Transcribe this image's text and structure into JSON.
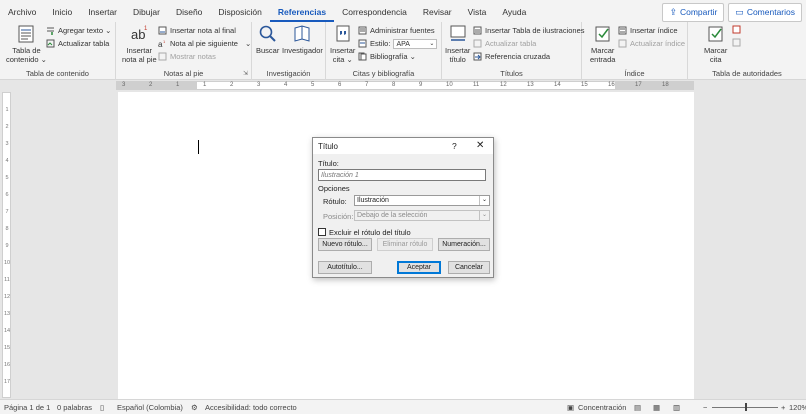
{
  "tabs": [
    "Archivo",
    "Inicio",
    "Insertar",
    "Dibujar",
    "Diseño",
    "Disposición",
    "Referencias",
    "Correspondencia",
    "Revisar",
    "Vista",
    "Ayuda"
  ],
  "active_tab": "Referencias",
  "share_label": "Compartir",
  "comments_label": "Comentarios",
  "ribbon": {
    "toc": {
      "group_label": "Tabla de contenido",
      "table_btn_line1": "Tabla de",
      "table_btn_line2": "contenido ⌄",
      "add_text": "Agregar texto ⌄",
      "update_table": "Actualizar tabla"
    },
    "footnotes": {
      "group_label": "Notas al pie",
      "insert_line1": "Insertar",
      "insert_line2": "nota al pie",
      "endnote": "Insertar nota al final",
      "next_note": "Nota al pie siguiente",
      "show_notes": "Mostrar notas"
    },
    "research": {
      "group_label": "Investigación",
      "search": "Buscar",
      "researcher": "Investigador"
    },
    "citations": {
      "group_label": "Citas y bibliografía",
      "insert_line1": "Insertar",
      "insert_line2": "cita ⌄",
      "manage": "Administrar fuentes",
      "style_label": "Estilo:",
      "style_value": "APA",
      "bibliography": "Bibliografía ⌄"
    },
    "captions": {
      "group_label": "Títulos",
      "insert_line1": "Insertar",
      "insert_line2": "título",
      "insert_table": "Insertar Tabla de ilustraciones",
      "update_table": "Actualizar tabla",
      "cross_ref": "Referencia cruzada"
    },
    "index": {
      "group_label": "Índice",
      "mark_line1": "Marcar",
      "mark_line2": "entrada",
      "insert_index": "Insertar índice",
      "update_index": "Actualizar índice"
    },
    "authorities": {
      "group_label": "Tabla de autoridades",
      "mark_line1": "Marcar",
      "mark_line2": "cita"
    }
  },
  "ruler_numbers": [
    "3",
    "2",
    "1",
    "1",
    "2",
    "3",
    "4",
    "5",
    "6",
    "7",
    "8",
    "9",
    "10",
    "11",
    "12",
    "13",
    "14",
    "15",
    "16",
    "17",
    "18"
  ],
  "vruler_numbers": [
    "1",
    "2",
    "3",
    "4",
    "5",
    "6",
    "7",
    "8",
    "9",
    "10",
    "11",
    "12",
    "13",
    "14",
    "15",
    "16",
    "17"
  ],
  "dialog": {
    "title": "Título",
    "help": "?",
    "close": "✕",
    "caption_label": "Título:",
    "caption_value": "Ilustración 1",
    "options_label": "Opciones",
    "label_label": "Rótulo:",
    "label_value": "Ilustración",
    "position_label": "Posición:",
    "position_value": "Debajo de la selección",
    "exclude_label": "Excluir el rótulo del título",
    "new_label_btn": "Nuevo rótulo...",
    "delete_label_btn": "Eliminar rótulo",
    "numbering_btn": "Numeración...",
    "autocaption_btn": "Autotítulo...",
    "ok_btn": "Aceptar",
    "cancel_btn": "Cancelar"
  },
  "status": {
    "page": "Página 1 de 1",
    "words": "0 palabras",
    "language": "Español (Colombia)",
    "accessibility": "Accesibilidad: todo correcto",
    "focus": "Concentración",
    "zoom": "120%",
    "zoom_minus": "−",
    "zoom_plus": "+"
  }
}
